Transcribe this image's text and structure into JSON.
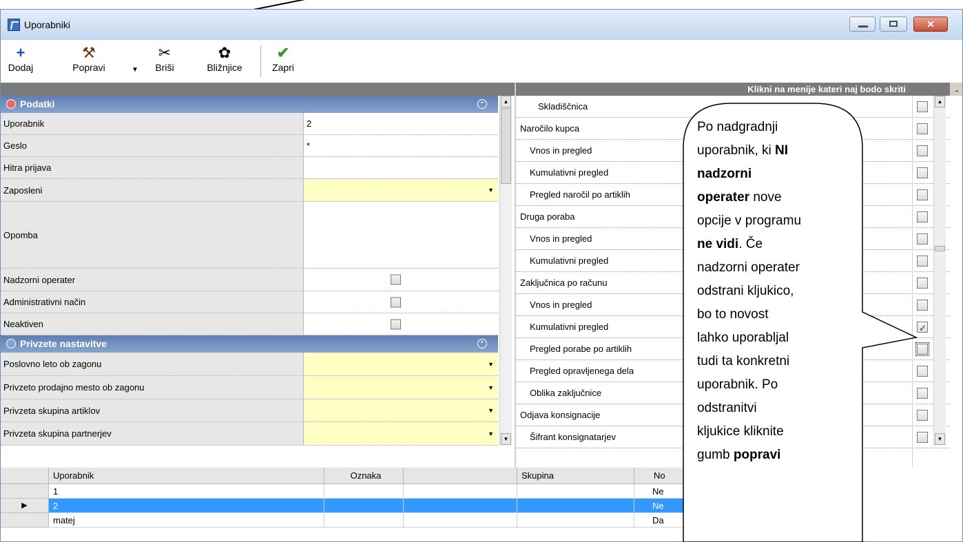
{
  "window": {
    "title": "Uporabniki",
    "close_label": "✕"
  },
  "toolbar": {
    "dodaj": "Dodaj",
    "popravi": "Popravi",
    "brisi": "Briši",
    "bliznjice": "Bližnjice",
    "zapri": "Zapri"
  },
  "right_header": "Klikni na menije kateri naj bodo skriti",
  "right_minus": "-",
  "sections": {
    "podatki": "Podatki",
    "privzete": "Privzete nastavitve"
  },
  "props": [
    {
      "label": "Uporabnik",
      "value": "2"
    },
    {
      "label": "Geslo",
      "value": "*"
    },
    {
      "label": "Hitra prijava",
      "value": ""
    },
    {
      "label": "Zaposleni",
      "value": ""
    },
    {
      "label": "Opomba",
      "value": ""
    },
    {
      "label": "Nadzorni operater",
      "value": ""
    },
    {
      "label": "Administrativni način",
      "value": ""
    },
    {
      "label": "Neaktiven",
      "value": ""
    }
  ],
  "defaults": [
    {
      "label": "Poslovno leto ob zagonu"
    },
    {
      "label": "Privzeto prodajno mesto ob zagonu"
    },
    {
      "label": "Privzeta skupina artiklov"
    },
    {
      "label": "Privzeta skupina partnerjev"
    }
  ],
  "menus": [
    {
      "label": "Skladiščnica",
      "checked": false
    },
    {
      "label": "Naročilo kupca",
      "checked": false
    },
    {
      "label": "Vnos in pregled",
      "checked": false
    },
    {
      "label": "Kumulativni pregled",
      "checked": false
    },
    {
      "label": "Pregled naročil po artiklih",
      "checked": false
    },
    {
      "label": "Druga poraba",
      "checked": false
    },
    {
      "label": "Vnos in pregled",
      "checked": false
    },
    {
      "label": "Kumulativni pregled",
      "checked": false
    },
    {
      "label": "Zaključnica po računu",
      "checked": false
    },
    {
      "label": "Vnos in pregled",
      "checked": false
    },
    {
      "label": "Kumulativni pregled",
      "checked": true
    },
    {
      "label": "Pregled porabe po artiklih",
      "checked": false
    },
    {
      "label": "Pregled opravljenega dela",
      "checked": false
    },
    {
      "label": "Oblika zaključnice",
      "checked": false
    },
    {
      "label": "Odjava konsignacije",
      "checked": false
    },
    {
      "label": "Šifrant konsignatarjev",
      "checked": false
    }
  ],
  "grid": {
    "headers": {
      "uporabnik": "Uporabnik",
      "oznaka": "Oznaka",
      "skupina": "Skupina",
      "no": "No"
    },
    "rows": [
      {
        "uporabnik": "1",
        "no": "Ne"
      },
      {
        "uporabnik": "2",
        "no": "Ne"
      },
      {
        "uporabnik": "matej",
        "no": "Da"
      }
    ]
  },
  "callout": {
    "l1": "Po nadgradnji",
    "l2": "uporabnik, ki",
    "l2b": "NI",
    "l3": "nadzorni",
    "l4": "operater",
    "l4b": "nove",
    "l5": "opcije v programu",
    "l6": "ne vidi",
    "l6b": ". Če",
    "l7": "nadzorni operater",
    "l8": "odstrani kljukico,",
    "l9": "bo to novost",
    "l10": "lahko uporabljal",
    "l11": "tudi ta konkretni",
    "l12": "uporabnik. Po",
    "l13": "odstranitvi",
    "l14": "kljukice kliknite",
    "l15": "gumb",
    "l15b": "popravi"
  },
  "colors": {
    "selection": "#3399ff",
    "section_header": "#6f8fc0",
    "yellow_field": "#ffffc4"
  }
}
